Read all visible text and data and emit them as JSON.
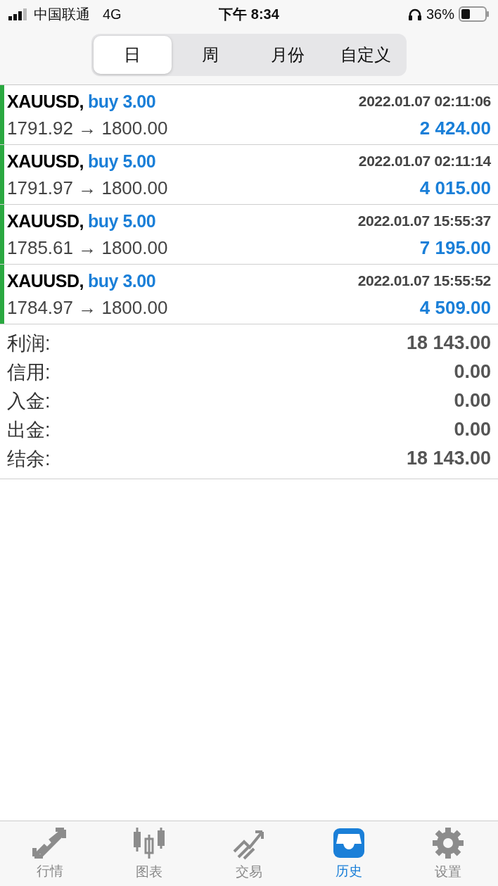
{
  "status_bar": {
    "carrier": "中国联通",
    "network": "4G",
    "time": "下午 8:34",
    "battery": "36%"
  },
  "segments": [
    {
      "label": "日",
      "selected": true
    },
    {
      "label": "周",
      "selected": false
    },
    {
      "label": "月份",
      "selected": false
    },
    {
      "label": "自定义",
      "selected": false
    }
  ],
  "trades": [
    {
      "symbol": "XAUUSD,",
      "order": "buy 3.00",
      "time": "2022.01.07 02:11:06",
      "prices": "1791.92 → 1800.00",
      "profit": "2 424.00"
    },
    {
      "symbol": "XAUUSD,",
      "order": "buy 5.00",
      "time": "2022.01.07 02:11:14",
      "prices": "1791.97 → 1800.00",
      "profit": "4 015.00"
    },
    {
      "symbol": "XAUUSD,",
      "order": "buy 5.00",
      "time": "2022.01.07 15:55:37",
      "prices": "1785.61 → 1800.00",
      "profit": "7 195.00"
    },
    {
      "symbol": "XAUUSD,",
      "order": "buy 3.00",
      "time": "2022.01.07 15:55:52",
      "prices": "1784.97 → 1800.00",
      "profit": "4 509.00"
    }
  ],
  "summary": [
    {
      "label": "利润:",
      "value": "18 143.00"
    },
    {
      "label": "信用:",
      "value": "0.00"
    },
    {
      "label": "入金:",
      "value": "0.00"
    },
    {
      "label": "出金:",
      "value": "0.00"
    },
    {
      "label": "结余:",
      "value": "18 143.00"
    }
  ],
  "tab_bar": [
    {
      "label": "行情",
      "kind": "quotes",
      "selected": false
    },
    {
      "label": "图表",
      "kind": "chart",
      "selected": false
    },
    {
      "label": "交易",
      "kind": "trade",
      "selected": false
    },
    {
      "label": "历史",
      "kind": "history",
      "selected": true
    },
    {
      "label": "设置",
      "kind": "settings",
      "selected": false
    }
  ]
}
